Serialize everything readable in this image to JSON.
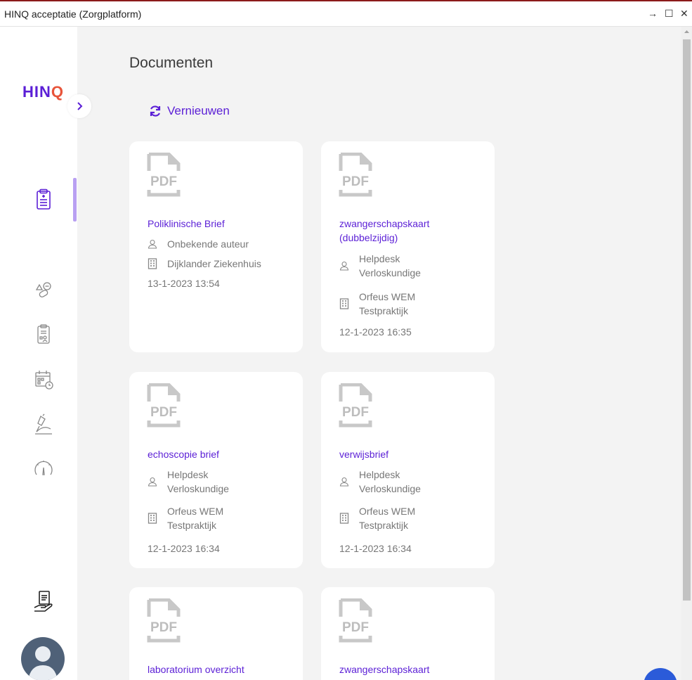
{
  "window": {
    "title": "HINQ acceptatie (Zorgplatform)",
    "controls": [
      "→",
      "☐",
      "✕"
    ]
  },
  "sidebar": {
    "logo": "HIN",
    "logo_q": "Q",
    "nav_icons": [
      "clipboard-icon",
      "shapes-icon",
      "patient-record-icon",
      "calendar-clock-icon",
      "microscope-icon",
      "gauge-icon",
      "document-hand-icon"
    ]
  },
  "main": {
    "title": "Documenten",
    "refresh_label": "Vernieuwen",
    "documents": [
      {
        "title": "Poliklinische Brief",
        "author": "Onbekende auteur",
        "org": "Dijklander Ziekenhuis",
        "date": "13-1-2023 13:54"
      },
      {
        "title": "zwangerschapskaart (dubbelzijdig)",
        "author": "Helpdesk Verloskundige",
        "org": "Orfeus WEM Testpraktijk",
        "date": "12-1-2023 16:35"
      },
      {
        "title": "echoscopie brief",
        "author": "Helpdesk Verloskundige",
        "org": "Orfeus WEM Testpraktijk",
        "date": "12-1-2023 16:34"
      },
      {
        "title": "verwijsbrief",
        "author": "Helpdesk Verloskundige",
        "org": "Orfeus WEM Testpraktijk",
        "date": "12-1-2023 16:34"
      },
      {
        "title": "laboratorium overzicht"
      },
      {
        "title": "zwangerschapskaart"
      }
    ],
    "pdf_label": "PDF"
  },
  "colors": {
    "accent": "#5b1fd6",
    "logo_q": "#e8543a",
    "titlebar_border": "#8b1a1a",
    "background": "#f3f3f3"
  }
}
